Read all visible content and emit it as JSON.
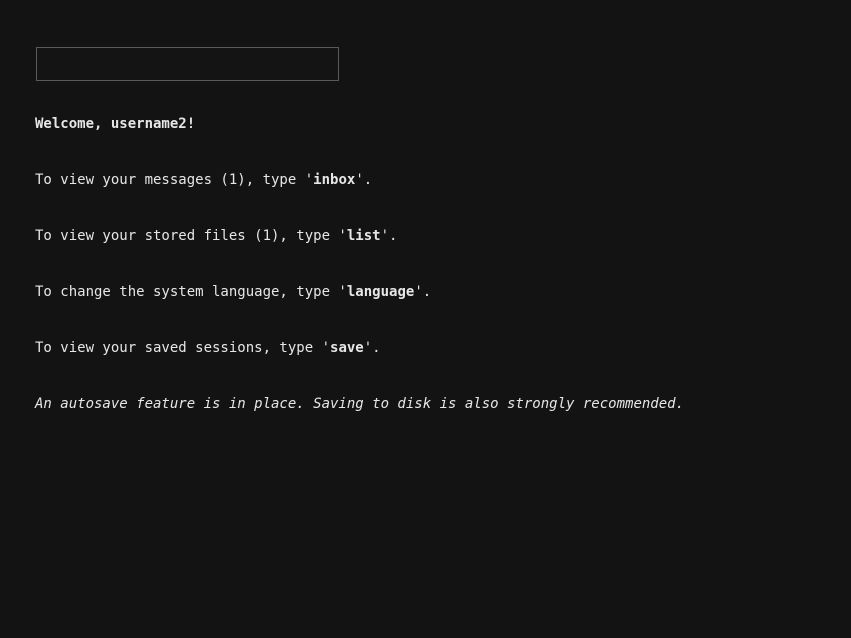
{
  "input": {
    "value": "",
    "placeholder": ""
  },
  "welcome": "Welcome, username2!",
  "lines": [
    {
      "prefix": "To view your messages (1), type '",
      "command": "inbox",
      "suffix": "'."
    },
    {
      "prefix": "To view your stored files (1), type '",
      "command": "list",
      "suffix": "'."
    },
    {
      "prefix": "To change the system language, type '",
      "command": "language",
      "suffix": "'."
    },
    {
      "prefix": "To view your saved sessions, type '",
      "command": "save",
      "suffix": "'."
    }
  ],
  "note": "An autosave feature is in place. Saving to disk is also strongly recommended.",
  "colors": {
    "background": "#131313",
    "text": "#e6e6e6",
    "input_border": "#5a5a5a"
  }
}
